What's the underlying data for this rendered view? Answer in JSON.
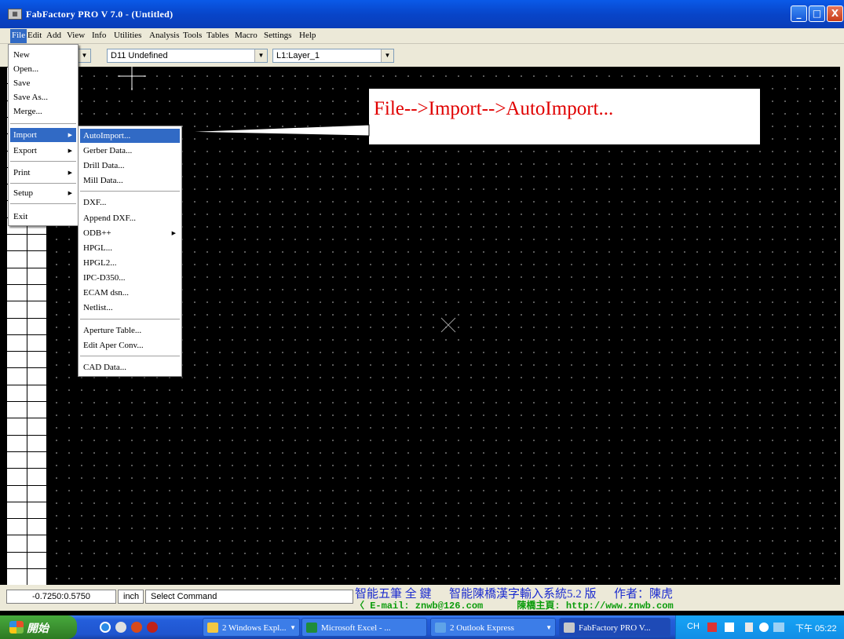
{
  "window": {
    "title": "FabFactory PRO V 7.0 - (Untitled)",
    "minimize": "_",
    "maximize": "□",
    "close": "X"
  },
  "menubar": [
    "File",
    "Edit",
    "Add",
    "View",
    "Info",
    "Utilities",
    "Analysis",
    "Tools",
    "Tables",
    "Macro",
    "Settings",
    "Help"
  ],
  "toolbar": {
    "dcode_combo": "D11  Undefined",
    "layer_combo": "L1:Layer_1"
  },
  "file_menu": {
    "items": [
      "New",
      "Open...",
      "Save",
      "Save As...",
      "Merge...",
      "Import",
      "Export",
      "Print",
      "Setup",
      "Exit"
    ]
  },
  "import_menu": {
    "items": [
      "AutoImport...",
      "Gerber Data...",
      "Drill Data...",
      "Mill Data...",
      "DXF...",
      "Append DXF...",
      "ODB++",
      "HPGL...",
      "HPGL2...",
      "IPC-D350...",
      "ECAM dsn...",
      "Netlist...",
      "Aperture Table...",
      "Edit Aper Conv...",
      "CAD Data..."
    ]
  },
  "callout": {
    "text": "File-->Import-->AutoImport..."
  },
  "statusbar": {
    "coords": "-0.7250:0.5750",
    "units": "inch",
    "command": "Select Command"
  },
  "ime": {
    "line1": "智能五筆 全 鍵      智能陳橋漢字輸入系統5.2 版      作者：陳虎",
    "line2": "〈 E-mail: znwb@126.com      陳橋主頁: http://www.znwb.com"
  },
  "taskbar": {
    "start": "開始",
    "tasks": [
      "2 Windows Expl...",
      "Microsoft Excel - ...",
      "2 Outlook Express",
      "FabFactory PRO V..."
    ],
    "tray_lang": "CH",
    "clock": "下午 05:22"
  },
  "colors": {
    "title_blue": "#0845c9",
    "highlight": "#316ac5",
    "callout_red": "#e00000",
    "ime_blue": "#1c2ccf",
    "ime_green": "#0b9c0b"
  }
}
